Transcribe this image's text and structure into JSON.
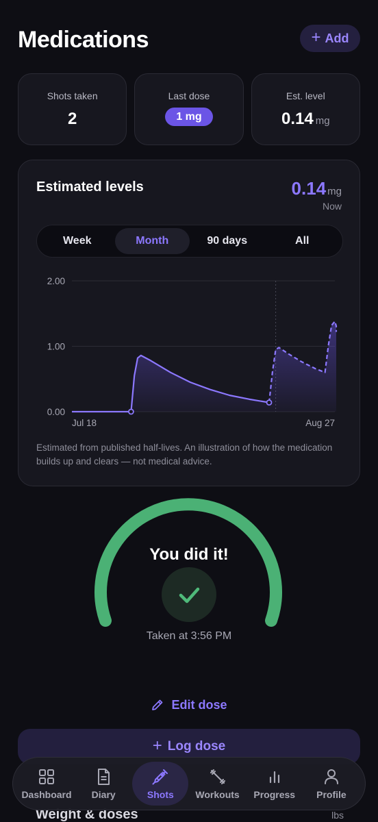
{
  "header": {
    "title": "Medications",
    "add_label": "Add"
  },
  "stats": {
    "shots_taken_label": "Shots taken",
    "shots_taken_value": "2",
    "last_dose_label": "Last dose",
    "last_dose_value": "1 mg",
    "est_level_label": "Est. level",
    "est_level_value": "0.14",
    "est_level_unit": "mg"
  },
  "levels": {
    "title": "Estimated levels",
    "current_value": "0.14",
    "current_unit": "mg",
    "current_sub": "Now",
    "tabs": [
      "Week",
      "Month",
      "90 days",
      "All"
    ],
    "active_tab": "Month",
    "disclaimer": "Estimated from published half-lives. An illustration of how the medication builds up and clears — not medical advice."
  },
  "chart_data": {
    "type": "area",
    "title": "",
    "xlabel": "",
    "ylabel": "",
    "x_tick_labels": [
      "Jul 18",
      "Aug 27"
    ],
    "y_ticks": [
      "2.00",
      "1.00",
      "0.00"
    ],
    "ylim": [
      0,
      2
    ],
    "x_day_range": [
      0,
      40
    ],
    "series": [
      {
        "style": "solid",
        "points": [
          [
            0,
            0
          ],
          [
            9,
            0
          ],
          [
            9.5,
            0.55
          ],
          [
            10,
            0.82
          ],
          [
            10.5,
            0.86
          ],
          [
            12,
            0.78
          ],
          [
            15,
            0.6
          ],
          [
            18,
            0.45
          ],
          [
            21,
            0.34
          ],
          [
            24,
            0.25
          ],
          [
            27,
            0.19
          ],
          [
            30,
            0.14
          ]
        ]
      },
      {
        "style": "dashed",
        "points": [
          [
            30,
            0.14
          ],
          [
            30.5,
            0.6
          ],
          [
            31,
            0.95
          ],
          [
            31.5,
            0.98
          ],
          [
            33,
            0.88
          ],
          [
            35,
            0.76
          ],
          [
            37,
            0.66
          ],
          [
            38.5,
            0.6
          ],
          [
            39,
            1.0
          ],
          [
            39.5,
            1.32
          ],
          [
            40,
            1.38
          ],
          [
            41,
            1.31
          ],
          [
            42,
            1.22
          ]
        ]
      }
    ],
    "dose_markers": [
      [
        9,
        0
      ],
      [
        30,
        0.14
      ]
    ],
    "now_marker_day": 31,
    "grid": true,
    "accent_color": "#8c78ff"
  },
  "gauge": {
    "title": "You did it!",
    "subtitle": "Taken at 3:56 PM",
    "color": "#4fba7a"
  },
  "actions": {
    "edit_dose": "Edit dose",
    "log_dose": "Log dose"
  },
  "peek_section": {
    "title": "Weight & doses",
    "unit": "lbs"
  },
  "nav": {
    "items": [
      {
        "label": "Dashboard",
        "icon": "grid-icon"
      },
      {
        "label": "Diary",
        "icon": "document-icon"
      },
      {
        "label": "Shots",
        "icon": "syringe-icon"
      },
      {
        "label": "Workouts",
        "icon": "dumbbell-icon"
      },
      {
        "label": "Progress",
        "icon": "bar-chart-icon"
      },
      {
        "label": "Profile",
        "icon": "person-icon"
      }
    ],
    "active": "Shots"
  }
}
